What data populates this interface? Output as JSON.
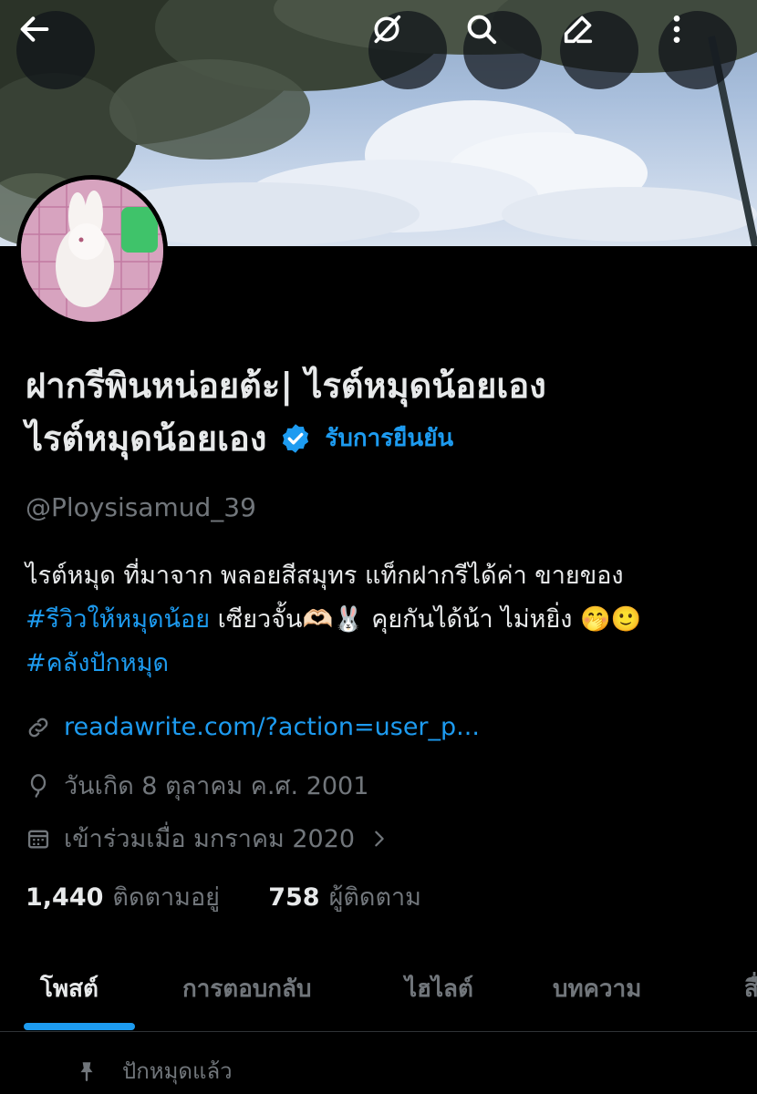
{
  "profile": {
    "name_line1": "ฝากรีพินหน่อยต้ะ| ไรต์หมุดน้อยเอง",
    "name_line2": "ไรต์หมุดน้อยเอง",
    "verify_label": "รับการยืนยัน",
    "handle": "@Ploysisamud_39",
    "bio": {
      "line1": "ไรต์หมุด ที่มาจาก พลอยสีสมุทร แท็กฝากรีได้ค่า ขายของ",
      "hashtag1": "#รีวิวให้หมุดน้อย",
      "line2_rest": " เซียวจั้น🫶🏻🐰  คุยกันได้น้า ไม่หยิ่ง 🤭🙂",
      "hashtag2": "#คลังปักหมุด"
    },
    "website": "readawrite.com/?action=user_p...",
    "birthday": "วันเกิด 8 ตุลาคม ค.ศ. 2001",
    "joined": "เข้าร่วมเมื่อ มกราคม 2020",
    "following_count": "1,440",
    "following_label": "ติดตามอยู่",
    "followers_count": "758",
    "followers_label": "ผู้ติดตาม"
  },
  "tabs": [
    {
      "label": "โพสต์",
      "active": true
    },
    {
      "label": "การตอบกลับ",
      "active": false
    },
    {
      "label": "ไฮไลต์",
      "active": false
    },
    {
      "label": "บทความ",
      "active": false
    },
    {
      "label": "สื่อ",
      "active": false
    }
  ],
  "pinned_label": "ปักหมุดแล้ว",
  "icons": {
    "back": "back-arrow-icon",
    "grok": "grok-icon",
    "search": "search-icon",
    "edit": "edit-icon",
    "more": "more-icon"
  },
  "colors": {
    "accent": "#1d9bf0",
    "background": "#000000",
    "muted": "#71767b"
  }
}
